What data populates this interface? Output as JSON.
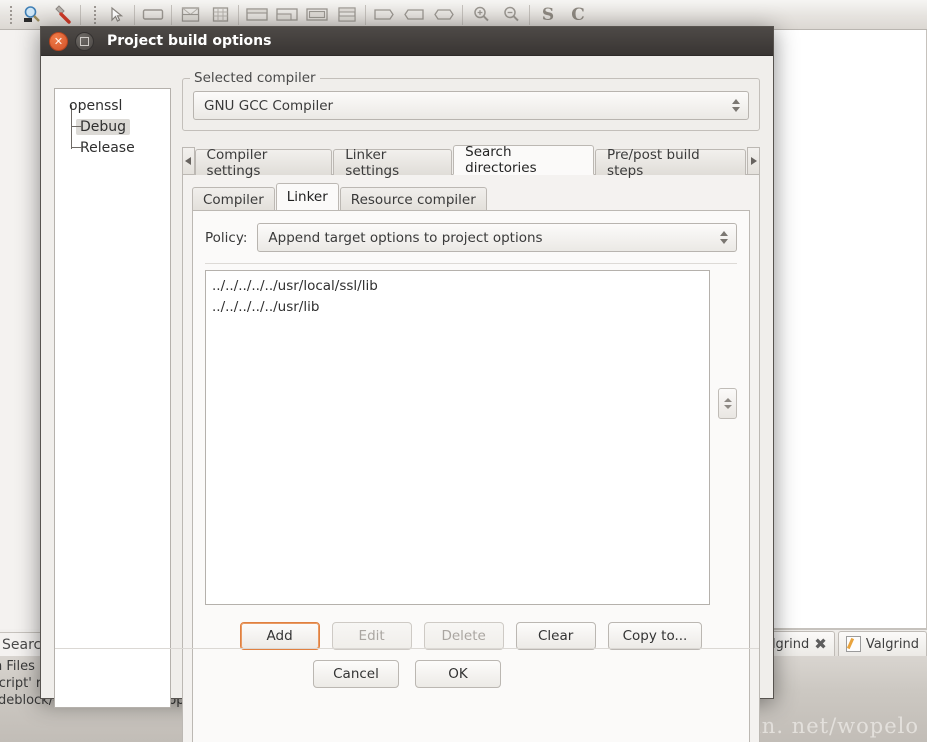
{
  "background": {
    "toolbar": {
      "items": [
        {
          "name": "magnifier-icon",
          "glyph": "magnifier"
        },
        {
          "name": "wrench-icon",
          "glyph": "wrench"
        },
        {
          "name": "pointer-icon",
          "glyph": "pointer"
        },
        {
          "name": "rectangle-icon",
          "glyph": "rect"
        },
        {
          "name": "split-horizontal-icon",
          "glyph": "splith"
        },
        {
          "name": "grid-layout-icon",
          "glyph": "grid"
        },
        {
          "name": "layout-top-icon",
          "glyph": "lay1"
        },
        {
          "name": "layout-bottom-icon",
          "glyph": "lay2"
        },
        {
          "name": "layout-fill-icon",
          "glyph": "lay3"
        },
        {
          "name": "layout-rows-icon",
          "glyph": "lay4"
        },
        {
          "name": "shape-right-icon",
          "glyph": "sh1"
        },
        {
          "name": "shape-left-icon",
          "glyph": "sh2"
        },
        {
          "name": "shape-hex-icon",
          "glyph": "sh3"
        },
        {
          "name": "zoom-in-icon",
          "glyph": "zoomin"
        },
        {
          "name": "zoom-out-icon",
          "glyph": "zoomout"
        },
        {
          "name": "letter-s-icon",
          "glyph": "S"
        },
        {
          "name": "letter-c-icon",
          "glyph": "C"
        }
      ]
    },
    "search_label": "Search",
    "status_tabs": [
      {
        "label": "lgrind",
        "icon": "close-x-icon"
      },
      {
        "label": "Valgrind",
        "icon": "note-icon"
      }
    ],
    "log_lines": [
      "n Files p",
      "script' registered under menu '&Settings/-Edit startup script'",
      "odeblock/openssl/openssl.cbp"
    ],
    "watermark": "http://blog. csdn. net/wopelo"
  },
  "dialog": {
    "title": "Project build options",
    "titlebar_buttons": {
      "close": "close-button",
      "maximize": "maximize-button"
    },
    "tree": [
      {
        "label": "openssl",
        "selected": false,
        "level": 0
      },
      {
        "label": "Debug",
        "selected": true,
        "level": 1
      },
      {
        "label": "Release",
        "selected": false,
        "level": 1
      }
    ],
    "compiler_group": {
      "title": "Selected compiler",
      "selected": "GNU GCC Compiler"
    },
    "outer_tabs": [
      {
        "label": "Compiler settings",
        "active": false
      },
      {
        "label": "Linker settings",
        "active": false
      },
      {
        "label": "Search directories",
        "active": true
      },
      {
        "label": "Pre/post build steps",
        "active": false
      }
    ],
    "inner_tabs": [
      {
        "label": "Compiler",
        "active": false
      },
      {
        "label": "Linker",
        "active": true
      },
      {
        "label": "Resource compiler",
        "active": false
      }
    ],
    "policy": {
      "label": "Policy:",
      "value": "Append target options to project options"
    },
    "directories": [
      "../../../../../usr/local/ssl/lib",
      "../../../../../usr/lib"
    ],
    "action_buttons": [
      {
        "label": "Add",
        "state": "focused"
      },
      {
        "label": "Edit",
        "state": "disabled"
      },
      {
        "label": "Delete",
        "state": "disabled"
      },
      {
        "label": "Clear",
        "state": "normal"
      },
      {
        "label": "Copy to...",
        "state": "normal"
      }
    ],
    "footer_buttons": [
      {
        "label": "Cancel"
      },
      {
        "label": "OK"
      }
    ]
  },
  "colors": {
    "accent_orange": "#e08040",
    "titlebar": "#3e3a37",
    "close_button": "#e06a38"
  }
}
